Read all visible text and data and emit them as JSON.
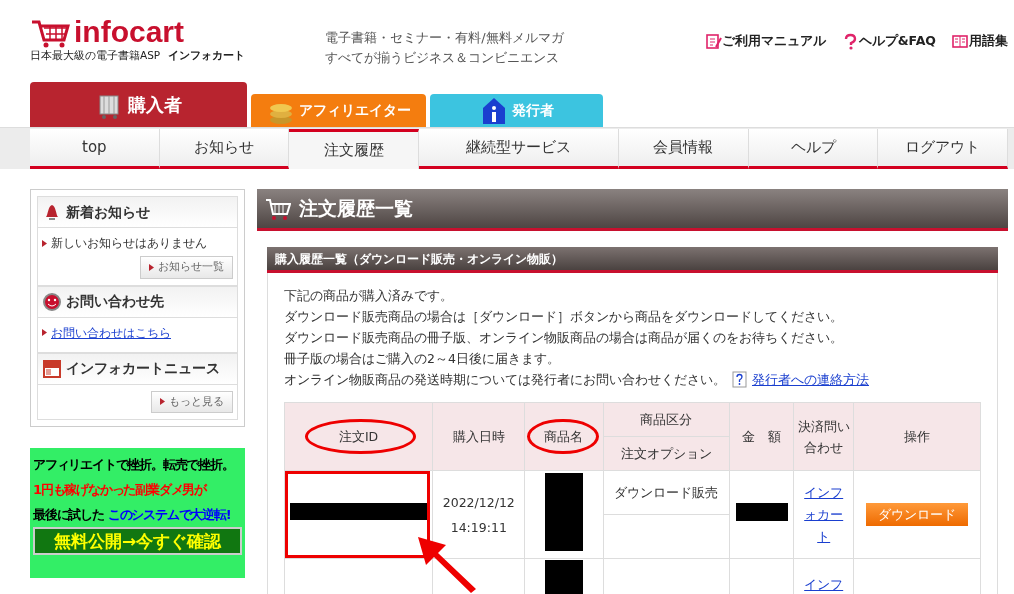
{
  "header": {
    "logo": "infocart",
    "logo_tagline": "日本最大級の電子書籍ASP",
    "logo_sub": "インフォカート",
    "catch_lines": [
      "電子書籍・セミナー・有料/無料メルマガ",
      "すべてが揃うビジネス＆コンビニエンス"
    ],
    "links": [
      {
        "label": "ご利用マニュアル",
        "kind": "manual"
      },
      {
        "label": "ヘルプ&FAQ",
        "kind": "help"
      },
      {
        "label": "用語集",
        "kind": "book"
      }
    ]
  },
  "role_tabs": [
    {
      "label": "購入者",
      "kind": "basket",
      "color": "#b8242f",
      "selected": true
    },
    {
      "label": "アフィリエイター",
      "kind": "coins",
      "color": "#f47d0f",
      "selected": false
    },
    {
      "label": "発行者",
      "kind": "info",
      "color": "#3cc4e0",
      "selected": false
    }
  ],
  "nav": [
    {
      "label": "top",
      "selected": false
    },
    {
      "label": "お知らせ",
      "selected": false
    },
    {
      "label": "注文履歴",
      "selected": true
    },
    {
      "label": "継続型サービス",
      "selected": false
    },
    {
      "label": "会員情報",
      "selected": false
    },
    {
      "label": "ヘルプ",
      "selected": false
    },
    {
      "label": "ログアウト",
      "selected": false
    }
  ],
  "sidebar": [
    {
      "title": "新着お知らせ",
      "kind": "bell",
      "items": [
        {
          "text": "新しいお知らせはありません",
          "kind": "text"
        }
      ],
      "button": "お知らせ一覧"
    },
    {
      "title": "お問い合わせ先",
      "kind": "support",
      "items": [
        {
          "text": "お問い合わせはこちら",
          "kind": "link"
        }
      ]
    },
    {
      "title": "インフォカートニュース",
      "kind": "news",
      "button": "もっと見る"
    }
  ],
  "banner": {
    "rows": [
      [
        {
          "text": "アフィリエイトで挫折。転売で挫折。",
          "color": "#000000"
        }
      ],
      [
        {
          "text": "1円も稼げなかった副業ダメ男が",
          "color": "#ff0000"
        }
      ],
      [
        {
          "text": "最後に試した",
          "color": "#000000"
        },
        {
          "text": "このシステムで大逆転!",
          "color": "#0000ff"
        }
      ]
    ],
    "cta": "無料公開→今すぐ確認"
  },
  "main": {
    "title": "注文履歴一覧",
    "panel_title": "購入履歴一覧（ダウンロード販売・オンライン物販）",
    "notes": [
      "下記の商品が購入済みです。",
      "ダウンロード販売商品の場合は［ダウンロード］ボタンから商品をダウンロードしてください。",
      "ダウンロード販売商品の冊子版、オンライン物販商品の場合は商品が届くのをお待ちください。",
      "冊子版の場合はご購入の2～4日後に届きます。",
      "オンライン物販商品の発送時期については発行者にお問い合わせください。"
    ],
    "help_link": "発行者への連絡方法",
    "table": {
      "columns": [
        {
          "label": "注文ID",
          "circled": true
        },
        {
          "label": "購入日時",
          "circled": false
        },
        {
          "label": "商品名",
          "circled": true
        },
        {
          "label": "商品区分",
          "sub_label": "注文オプション",
          "circled": false
        },
        {
          "label": "金　額",
          "circled": false
        },
        {
          "label": "決済問い合わせ",
          "circled": false
        },
        {
          "label": "操作",
          "circled": false
        }
      ],
      "rows": [
        {
          "order_id_redacted": true,
          "order_id_boxed": true,
          "arrow": true,
          "date": "2022/12/12",
          "time": "14:19:11",
          "product_redacted": true,
          "category": "ダウンロード販売",
          "amount_redacted": true,
          "contact": "インフォカート",
          "action": "ダウンロード"
        },
        {
          "order_id_redacted": false,
          "order_id_boxed": false,
          "arrow": false,
          "product_redacted": true,
          "amount_redacted": false,
          "contact": "インフ"
        }
      ]
    }
  }
}
